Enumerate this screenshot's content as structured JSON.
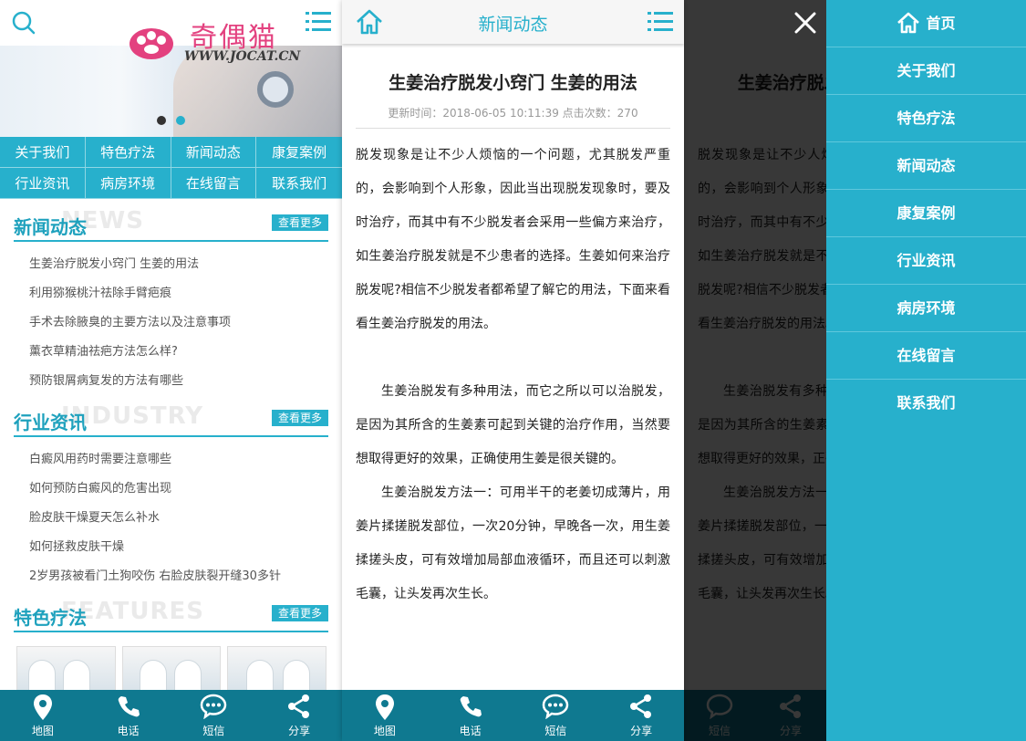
{
  "home": {
    "logo": {
      "brand": "奇偶猫",
      "url": "WWW.JOCAT.CN"
    },
    "nav": [
      "关于我们",
      "特色疗法",
      "新闻动态",
      "康复案例",
      "行业资讯",
      "病房环境",
      "在线留言",
      "联系我们"
    ],
    "news": {
      "title": "新闻动态",
      "en": "NEWS",
      "more": "查看更多",
      "items": [
        "生姜治疗脱发小窍门 生姜的用法",
        "利用猕猴桃汁祛除手臂疤痕",
        "手术去除腋臭的主要方法以及注意事项",
        "薰衣草精油祛疤方法怎么样?",
        "预防银屑病复发的方法有哪些"
      ]
    },
    "industry": {
      "title": "行业资讯",
      "en": "INDUSTRY",
      "more": "查看更多",
      "items": [
        "白癜风用药时需要注意哪些",
        "如何预防白癜风的危害出现",
        "脸皮肤干燥夏天怎么补水",
        "如何拯救皮肤干燥",
        "2岁男孩被看门土狗咬伤 右脸皮肤裂开缝30多针"
      ]
    },
    "features": {
      "title": "特色疗法",
      "en": "FEATURES",
      "more": "查看更多"
    }
  },
  "bottom_bar": [
    {
      "label": "地图",
      "icon": "map-pin-icon"
    },
    {
      "label": "电话",
      "icon": "phone-icon"
    },
    {
      "label": "短信",
      "icon": "message-icon"
    },
    {
      "label": "分享",
      "icon": "share-icon"
    }
  ],
  "article": {
    "header_title": "新闻动态",
    "title": "生姜治疗脱发小窍门 生姜的用法",
    "meta": "更新时间：2018-06-05 10:11:39  点击次数：270",
    "paragraphs": [
      "脱发现象是让不少人烦恼的一个问题，尤其脱发严重的，会影响到个人形象，因此当出现脱发现象时，要及时治疗，而其中有不少脱发者会采用一些偏方来治疗，如生姜治疗脱发就是不少患者的选择。生姜如何来治疗脱发呢?相信不少脱发者都希望了解它的用法，下面来看看生姜治疗脱发的用法。",
      "生姜治脱发有多种用法，而它之所以可以治脱发，是因为其所含的生姜素可起到关键的治疗作用，当然要想取得更好的效果，正确使用生姜是很关键的。",
      "生姜治脱发方法一：可用半干的老姜切成薄片，用姜片揉搓脱发部位，一次20分钟，早晚各一次，用生姜揉搓头皮，可有效增加局部血液循环，而且还可以刺激毛囊，让头发再次生长。"
    ]
  },
  "side_menu": [
    "首页",
    "关于我们",
    "特色疗法",
    "新闻动态",
    "康复案例",
    "行业资讯",
    "病房环境",
    "在线留言",
    "联系我们"
  ],
  "colors": {
    "accent": "#27b0cc",
    "bottom_bar": "#0f7990",
    "title": "#1ea1bd"
  }
}
